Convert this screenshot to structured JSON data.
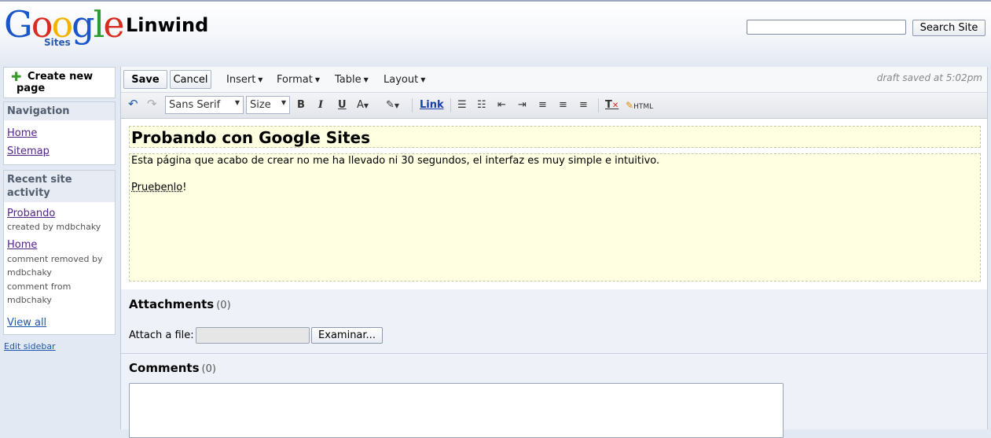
{
  "logo": {
    "word": "Google",
    "sub": "Sites"
  },
  "site": {
    "title": "Linwind"
  },
  "search": {
    "value": "",
    "button_label": "Search Site"
  },
  "sidebar": {
    "create_label": "Create new page",
    "navigation": {
      "heading": "Navigation",
      "items": [
        "Home",
        "Sitemap"
      ]
    },
    "recent": {
      "heading": "Recent site activity",
      "entries": [
        {
          "link": "Probando",
          "notes": [
            "created by mdbchaky"
          ]
        },
        {
          "link": "Home",
          "notes": [
            "comment removed by",
            "mdbchaky",
            "comment from",
            "mdbchaky"
          ]
        }
      ],
      "view_all": "View all"
    },
    "edit_sidebar": "Edit sidebar"
  },
  "toolbar": {
    "save": "Save",
    "cancel": "Cancel",
    "menus": [
      "Insert",
      "Format",
      "Table",
      "Layout"
    ],
    "draft_status": "draft saved at 5:02pm",
    "font_family": "Sans Serif",
    "font_size": "Size",
    "link_label": "Link",
    "html_label": "HTML"
  },
  "editor": {
    "title": "Probando con Google Sites",
    "paragraph": "Esta página que acabo de crear no me ha llevado ni 30 segundos, el interfaz es muy simple e intuitivo.",
    "line2_word": "Pruebenlo",
    "line2_end": "!"
  },
  "attachments": {
    "heading": "Attachments",
    "count": "(0)",
    "attach_label": "Attach a file:",
    "browse": "Examinar..."
  },
  "comments": {
    "heading": "Comments",
    "count": "(0)"
  }
}
